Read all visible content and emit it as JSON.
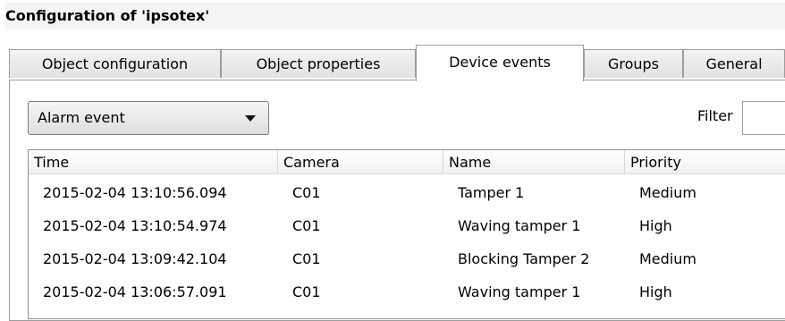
{
  "window": {
    "title": "Configuration of 'ipsotex'"
  },
  "tabs": [
    {
      "label": "Object configuration"
    },
    {
      "label": "Object properties"
    },
    {
      "label": "Device events"
    },
    {
      "label": "Groups"
    },
    {
      "label": "General"
    }
  ],
  "active_tab": "Device events",
  "event_type_select": {
    "value": "Alarm event"
  },
  "filter": {
    "label": "Filter",
    "value": ""
  },
  "table": {
    "columns": [
      "Time",
      "Camera",
      "Name",
      "Priority"
    ],
    "rows": [
      [
        "2015-02-04 13:10:56.094",
        "C01",
        "Tamper 1",
        "Medium"
      ],
      [
        "2015-02-04 13:10:54.974",
        "C01",
        "Waving tamper 1",
        "High"
      ],
      [
        "2015-02-04 13:09:42.104",
        "C01",
        "Blocking Tamper 2",
        "Medium"
      ],
      [
        "2015-02-04 13:06:57.091",
        "C01",
        "Waving tamper 1",
        "High"
      ]
    ]
  }
}
